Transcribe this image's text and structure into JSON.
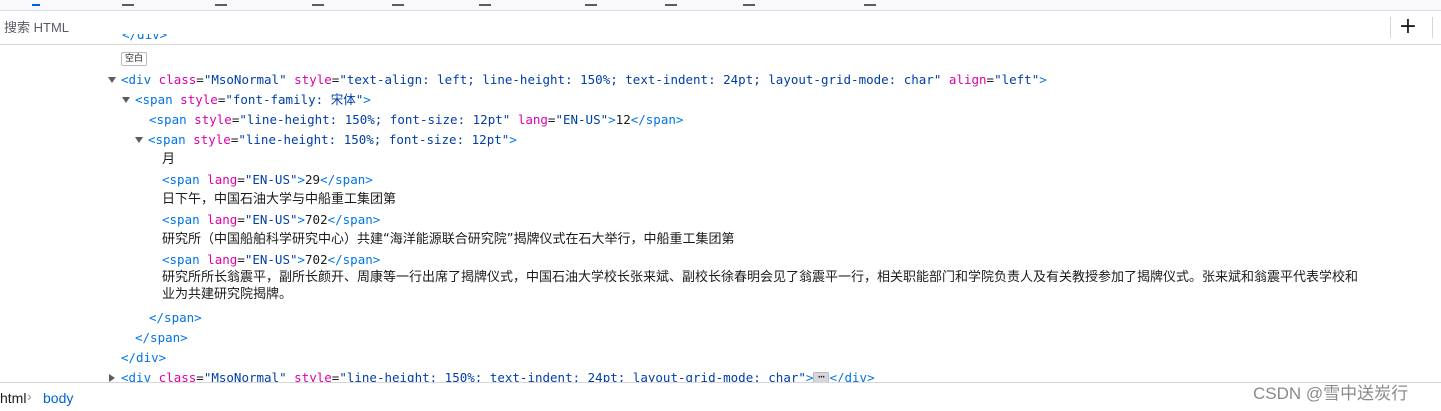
{
  "search": {
    "placeholder": "搜索 HTML"
  },
  "toolbar": {
    "add_label": "+"
  },
  "tree": {
    "l0_close": "</div>",
    "whitespace_badge": "空白",
    "l1": {
      "open": "<div",
      "a1": "class",
      "v1": "\"MsoNormal\"",
      "a2": "style",
      "v2": "\"text-align: left; line-height: 150%; text-indent: 24pt; layout-grid-mode: char\"",
      "a3": "align",
      "v3": "\"left\"",
      "close": ">"
    },
    "l2": {
      "open": "<span",
      "a1": "style",
      "v1": "\"font-family: 宋体\"",
      "close": ">"
    },
    "l3": {
      "open": "<span",
      "a1": "style",
      "v1": "\"line-height: 150%; font-size: 12pt\"",
      "a2": "lang",
      "v2": "\"EN-US\"",
      "text": "12",
      "end": "</span>"
    },
    "l4": {
      "open": "<span",
      "a1": "style",
      "v1": "\"line-height: 150%; font-size: 12pt\"",
      "close": ">"
    },
    "t1": "月",
    "l6": {
      "open": "<span",
      "a1": "lang",
      "v1": "\"EN-US\"",
      "text": "29",
      "end": "</span>"
    },
    "t2": "日下午，中国石油大学与中船重工集团第",
    "l8": {
      "open": "<span",
      "a1": "lang",
      "v1": "\"EN-US\"",
      "text": "702",
      "end": "</span>"
    },
    "t3": "研究所（中国船舶科学研究中心）共建“海洋能源联合研究院”揭牌仪式在石大举行，中船重工集团第",
    "l10": {
      "open": "<span",
      "a1": "lang",
      "v1": "\"EN-US\"",
      "text": "702",
      "end": "</span>"
    },
    "t4a": "研究所所长翁震平，副所长颜开、周康等一行出席了揭牌仪式，中国石油大学校长张来斌、副校长徐春明会见了翁震平一行，相关职能部门和学院负责人及有关教授参加了揭牌仪式。张来斌和翁震平代表学校和",
    "t4b": "业为共建研究院揭牌。",
    "close_span1": "</span>",
    "close_span2": "</span>",
    "close_div": "</div>",
    "l_last": {
      "open": "<div",
      "a1": "class",
      "v1": "\"MsoNormal\"",
      "a2": "style",
      "v2": "\"line-height: 150%; text-indent: 24pt; layout-grid-mode: char\"",
      "close": ">",
      "ellipsis": "⋯",
      "end": "</div>"
    }
  },
  "breadcrumbs": {
    "item1": "html",
    "sep": "›",
    "item2": "body"
  },
  "watermark": "CSDN @雪中送炭行",
  "colors": {
    "tag": "#0074e8",
    "attr": "#dd00a9",
    "value": "#003eaa",
    "link": "#0060df"
  }
}
